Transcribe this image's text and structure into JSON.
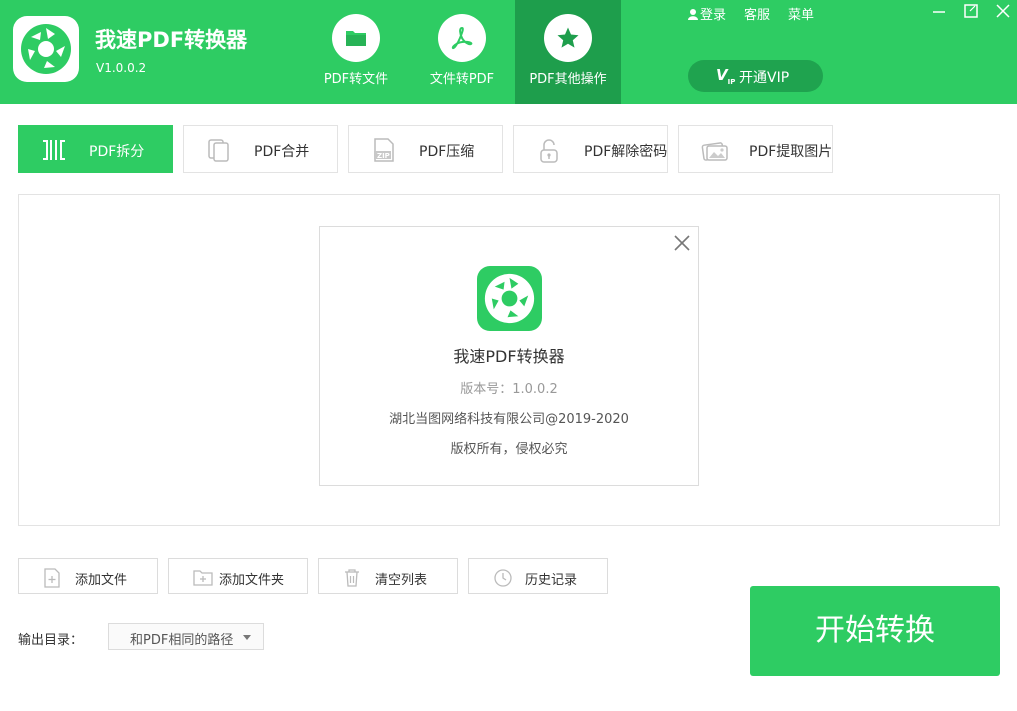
{
  "header": {
    "app_title": "我速PDF转换器",
    "version": "V1.0.0.2",
    "nav": [
      {
        "label": "PDF转文件",
        "icon": "folder-icon"
      },
      {
        "label": "文件转PDF",
        "icon": "acrobat-icon"
      },
      {
        "label": "PDF其他操作",
        "icon": "star-icon",
        "active": true
      }
    ],
    "links": {
      "login": "登录",
      "service": "客服",
      "menu": "菜单"
    },
    "vip": {
      "mark": "V",
      "mark_sub": "IP",
      "label": "开通VIP"
    }
  },
  "sub_tabs": [
    {
      "label": "PDF拆分",
      "icon": "split-icon",
      "active": true
    },
    {
      "label": "PDF合并",
      "icon": "merge-icon"
    },
    {
      "label": "PDF压缩",
      "icon": "zip-icon"
    },
    {
      "label": "PDF解除密码",
      "icon": "unlock-icon"
    },
    {
      "label": "PDF提取图片",
      "icon": "image-icon"
    }
  ],
  "about": {
    "name": "我速PDF转换器",
    "version": "版本号：1.0.0.2",
    "company": "湖北当图网络科技有限公司@2019-2020",
    "rights": "版权所有，侵权必究"
  },
  "actions": {
    "add_file": "添加文件",
    "add_folder": "添加文件夹",
    "clear_list": "清空列表",
    "history": "历史记录"
  },
  "output": {
    "label": "输出目录：",
    "value": "和PDF相同的路径"
  },
  "start_label": "开始转换",
  "colors": {
    "brand": "#2ecc63",
    "brand_dark": "#1e9e4c",
    "vip_bg": "#1fa34f"
  }
}
